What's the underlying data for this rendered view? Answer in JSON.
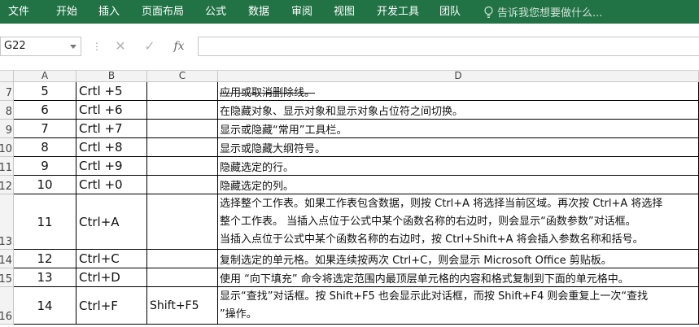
{
  "ribbon": {
    "tabs": [
      "文件",
      "开始",
      "插入",
      "页面布局",
      "公式",
      "数据",
      "审阅",
      "视图",
      "开发工具",
      "团队"
    ],
    "tell_me_placeholder": "告诉我您想要做什么..."
  },
  "formula_bar": {
    "name_box": "G22",
    "cancel_symbol": "✕",
    "enter_symbol": "✓",
    "fx_label": "fx",
    "formula_value": ""
  },
  "columns": [
    "A",
    "B",
    "C",
    "D"
  ],
  "rows": [
    {
      "num": "7",
      "a": "5",
      "b": "Crtl +5",
      "c": "",
      "d": [
        "应用或取消删除线。"
      ],
      "strike": true
    },
    {
      "num": "8",
      "a": "6",
      "b": "Crtl +6",
      "c": "",
      "d": [
        "在隐藏对象、显示对象和显示对象占位符之间切换。"
      ]
    },
    {
      "num": "9",
      "a": "7",
      "b": "Crtl +7",
      "c": "",
      "d": [
        "显示或隐藏“常用”工具栏。"
      ]
    },
    {
      "num": "10",
      "a": "8",
      "b": "Crtl +8",
      "c": "",
      "d": [
        "显示或隐藏大纲符号。"
      ]
    },
    {
      "num": "11",
      "a": "9",
      "b": "Crtl +9",
      "c": "",
      "d": [
        "隐藏选定的行。"
      ]
    },
    {
      "num": "12",
      "a": "10",
      "b": "Crtl +0",
      "c": "",
      "d": [
        "隐藏选定的列。"
      ]
    },
    {
      "num": "13",
      "a": "11",
      "b": "Ctrl+A",
      "c": "",
      "d": [
        "选择整个工作表。如果工作表包含数据，则按 Ctrl+A 将选择当前区域。再次按 Ctrl+A 将选择",
        "整个工作表。 当插入点位于公式中某个函数名称的右边时，则会显示“函数参数”对话框。",
        " 当插入点位于公式中某个函数名称的右边时，按 Ctrl+Shift+A 将会插入参数名称和括号。"
      ]
    },
    {
      "num": "14",
      "a": "12",
      "b": "Ctrl+C",
      "c": "",
      "d": [
        "复制选定的单元格。如果连续按两次 Ctrl+C，则会显示 Microsoft Office 剪贴板。"
      ]
    },
    {
      "num": "15",
      "a": "13",
      "b": "Ctrl+D",
      "c": "",
      "d": [
        " 使用 “向下填充” 命令将选定范围内最顶层单元格的内容和格式复制到下面的单元格中。"
      ]
    },
    {
      "num": "16",
      "a": "14",
      "b": "Ctrl+F",
      "c": "Shift+F5",
      "d": [
        "显示“查找”对话框。按 Shift+F5 也会显示此对话框，而按 Shift+F4 则会重复上一次“查找",
        "”操作。"
      ]
    }
  ]
}
